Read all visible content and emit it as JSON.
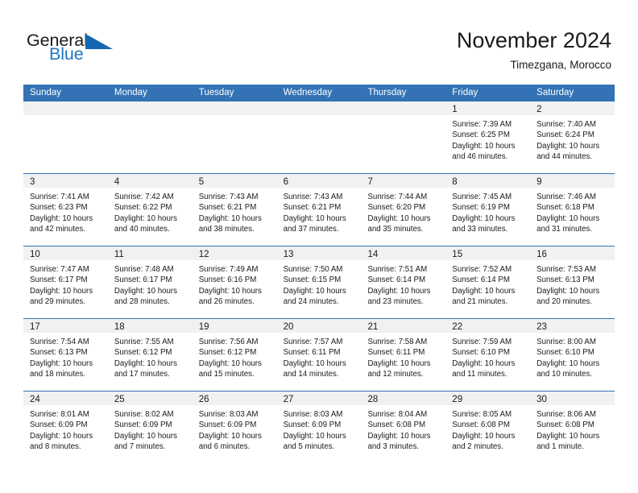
{
  "brand": {
    "name_part1": "General",
    "name_part2": "Blue",
    "accent_color": "#1667b3",
    "text_color": "#1a1a1a"
  },
  "header": {
    "title": "November 2024",
    "subtitle": "Timezgana, Morocco",
    "header_bg_color": "#3272b5",
    "number_band_color": "#f1f1f1"
  },
  "weekdays": [
    "Sunday",
    "Monday",
    "Tuesday",
    "Wednesday",
    "Thursday",
    "Friday",
    "Saturday"
  ],
  "weeks": [
    [
      {
        "day": "",
        "sunrise": "",
        "sunset": "",
        "daylight_line1": "",
        "daylight_line2": ""
      },
      {
        "day": "",
        "sunrise": "",
        "sunset": "",
        "daylight_line1": "",
        "daylight_line2": ""
      },
      {
        "day": "",
        "sunrise": "",
        "sunset": "",
        "daylight_line1": "",
        "daylight_line2": ""
      },
      {
        "day": "",
        "sunrise": "",
        "sunset": "",
        "daylight_line1": "",
        "daylight_line2": ""
      },
      {
        "day": "",
        "sunrise": "",
        "sunset": "",
        "daylight_line1": "",
        "daylight_line2": ""
      },
      {
        "day": "1",
        "sunrise": "Sunrise: 7:39 AM",
        "sunset": "Sunset: 6:25 PM",
        "daylight_line1": "Daylight: 10 hours",
        "daylight_line2": "and 46 minutes."
      },
      {
        "day": "2",
        "sunrise": "Sunrise: 7:40 AM",
        "sunset": "Sunset: 6:24 PM",
        "daylight_line1": "Daylight: 10 hours",
        "daylight_line2": "and 44 minutes."
      }
    ],
    [
      {
        "day": "3",
        "sunrise": "Sunrise: 7:41 AM",
        "sunset": "Sunset: 6:23 PM",
        "daylight_line1": "Daylight: 10 hours",
        "daylight_line2": "and 42 minutes."
      },
      {
        "day": "4",
        "sunrise": "Sunrise: 7:42 AM",
        "sunset": "Sunset: 6:22 PM",
        "daylight_line1": "Daylight: 10 hours",
        "daylight_line2": "and 40 minutes."
      },
      {
        "day": "5",
        "sunrise": "Sunrise: 7:43 AM",
        "sunset": "Sunset: 6:21 PM",
        "daylight_line1": "Daylight: 10 hours",
        "daylight_line2": "and 38 minutes."
      },
      {
        "day": "6",
        "sunrise": "Sunrise: 7:43 AM",
        "sunset": "Sunset: 6:21 PM",
        "daylight_line1": "Daylight: 10 hours",
        "daylight_line2": "and 37 minutes."
      },
      {
        "day": "7",
        "sunrise": "Sunrise: 7:44 AM",
        "sunset": "Sunset: 6:20 PM",
        "daylight_line1": "Daylight: 10 hours",
        "daylight_line2": "and 35 minutes."
      },
      {
        "day": "8",
        "sunrise": "Sunrise: 7:45 AM",
        "sunset": "Sunset: 6:19 PM",
        "daylight_line1": "Daylight: 10 hours",
        "daylight_line2": "and 33 minutes."
      },
      {
        "day": "9",
        "sunrise": "Sunrise: 7:46 AM",
        "sunset": "Sunset: 6:18 PM",
        "daylight_line1": "Daylight: 10 hours",
        "daylight_line2": "and 31 minutes."
      }
    ],
    [
      {
        "day": "10",
        "sunrise": "Sunrise: 7:47 AM",
        "sunset": "Sunset: 6:17 PM",
        "daylight_line1": "Daylight: 10 hours",
        "daylight_line2": "and 29 minutes."
      },
      {
        "day": "11",
        "sunrise": "Sunrise: 7:48 AM",
        "sunset": "Sunset: 6:17 PM",
        "daylight_line1": "Daylight: 10 hours",
        "daylight_line2": "and 28 minutes."
      },
      {
        "day": "12",
        "sunrise": "Sunrise: 7:49 AM",
        "sunset": "Sunset: 6:16 PM",
        "daylight_line1": "Daylight: 10 hours",
        "daylight_line2": "and 26 minutes."
      },
      {
        "day": "13",
        "sunrise": "Sunrise: 7:50 AM",
        "sunset": "Sunset: 6:15 PM",
        "daylight_line1": "Daylight: 10 hours",
        "daylight_line2": "and 24 minutes."
      },
      {
        "day": "14",
        "sunrise": "Sunrise: 7:51 AM",
        "sunset": "Sunset: 6:14 PM",
        "daylight_line1": "Daylight: 10 hours",
        "daylight_line2": "and 23 minutes."
      },
      {
        "day": "15",
        "sunrise": "Sunrise: 7:52 AM",
        "sunset": "Sunset: 6:14 PM",
        "daylight_line1": "Daylight: 10 hours",
        "daylight_line2": "and 21 minutes."
      },
      {
        "day": "16",
        "sunrise": "Sunrise: 7:53 AM",
        "sunset": "Sunset: 6:13 PM",
        "daylight_line1": "Daylight: 10 hours",
        "daylight_line2": "and 20 minutes."
      }
    ],
    [
      {
        "day": "17",
        "sunrise": "Sunrise: 7:54 AM",
        "sunset": "Sunset: 6:13 PM",
        "daylight_line1": "Daylight: 10 hours",
        "daylight_line2": "and 18 minutes."
      },
      {
        "day": "18",
        "sunrise": "Sunrise: 7:55 AM",
        "sunset": "Sunset: 6:12 PM",
        "daylight_line1": "Daylight: 10 hours",
        "daylight_line2": "and 17 minutes."
      },
      {
        "day": "19",
        "sunrise": "Sunrise: 7:56 AM",
        "sunset": "Sunset: 6:12 PM",
        "daylight_line1": "Daylight: 10 hours",
        "daylight_line2": "and 15 minutes."
      },
      {
        "day": "20",
        "sunrise": "Sunrise: 7:57 AM",
        "sunset": "Sunset: 6:11 PM",
        "daylight_line1": "Daylight: 10 hours",
        "daylight_line2": "and 14 minutes."
      },
      {
        "day": "21",
        "sunrise": "Sunrise: 7:58 AM",
        "sunset": "Sunset: 6:11 PM",
        "daylight_line1": "Daylight: 10 hours",
        "daylight_line2": "and 12 minutes."
      },
      {
        "day": "22",
        "sunrise": "Sunrise: 7:59 AM",
        "sunset": "Sunset: 6:10 PM",
        "daylight_line1": "Daylight: 10 hours",
        "daylight_line2": "and 11 minutes."
      },
      {
        "day": "23",
        "sunrise": "Sunrise: 8:00 AM",
        "sunset": "Sunset: 6:10 PM",
        "daylight_line1": "Daylight: 10 hours",
        "daylight_line2": "and 10 minutes."
      }
    ],
    [
      {
        "day": "24",
        "sunrise": "Sunrise: 8:01 AM",
        "sunset": "Sunset: 6:09 PM",
        "daylight_line1": "Daylight: 10 hours",
        "daylight_line2": "and 8 minutes."
      },
      {
        "day": "25",
        "sunrise": "Sunrise: 8:02 AM",
        "sunset": "Sunset: 6:09 PM",
        "daylight_line1": "Daylight: 10 hours",
        "daylight_line2": "and 7 minutes."
      },
      {
        "day": "26",
        "sunrise": "Sunrise: 8:03 AM",
        "sunset": "Sunset: 6:09 PM",
        "daylight_line1": "Daylight: 10 hours",
        "daylight_line2": "and 6 minutes."
      },
      {
        "day": "27",
        "sunrise": "Sunrise: 8:03 AM",
        "sunset": "Sunset: 6:09 PM",
        "daylight_line1": "Daylight: 10 hours",
        "daylight_line2": "and 5 minutes."
      },
      {
        "day": "28",
        "sunrise": "Sunrise: 8:04 AM",
        "sunset": "Sunset: 6:08 PM",
        "daylight_line1": "Daylight: 10 hours",
        "daylight_line2": "and 3 minutes."
      },
      {
        "day": "29",
        "sunrise": "Sunrise: 8:05 AM",
        "sunset": "Sunset: 6:08 PM",
        "daylight_line1": "Daylight: 10 hours",
        "daylight_line2": "and 2 minutes."
      },
      {
        "day": "30",
        "sunrise": "Sunrise: 8:06 AM",
        "sunset": "Sunset: 6:08 PM",
        "daylight_line1": "Daylight: 10 hours",
        "daylight_line2": "and 1 minute."
      }
    ]
  ]
}
